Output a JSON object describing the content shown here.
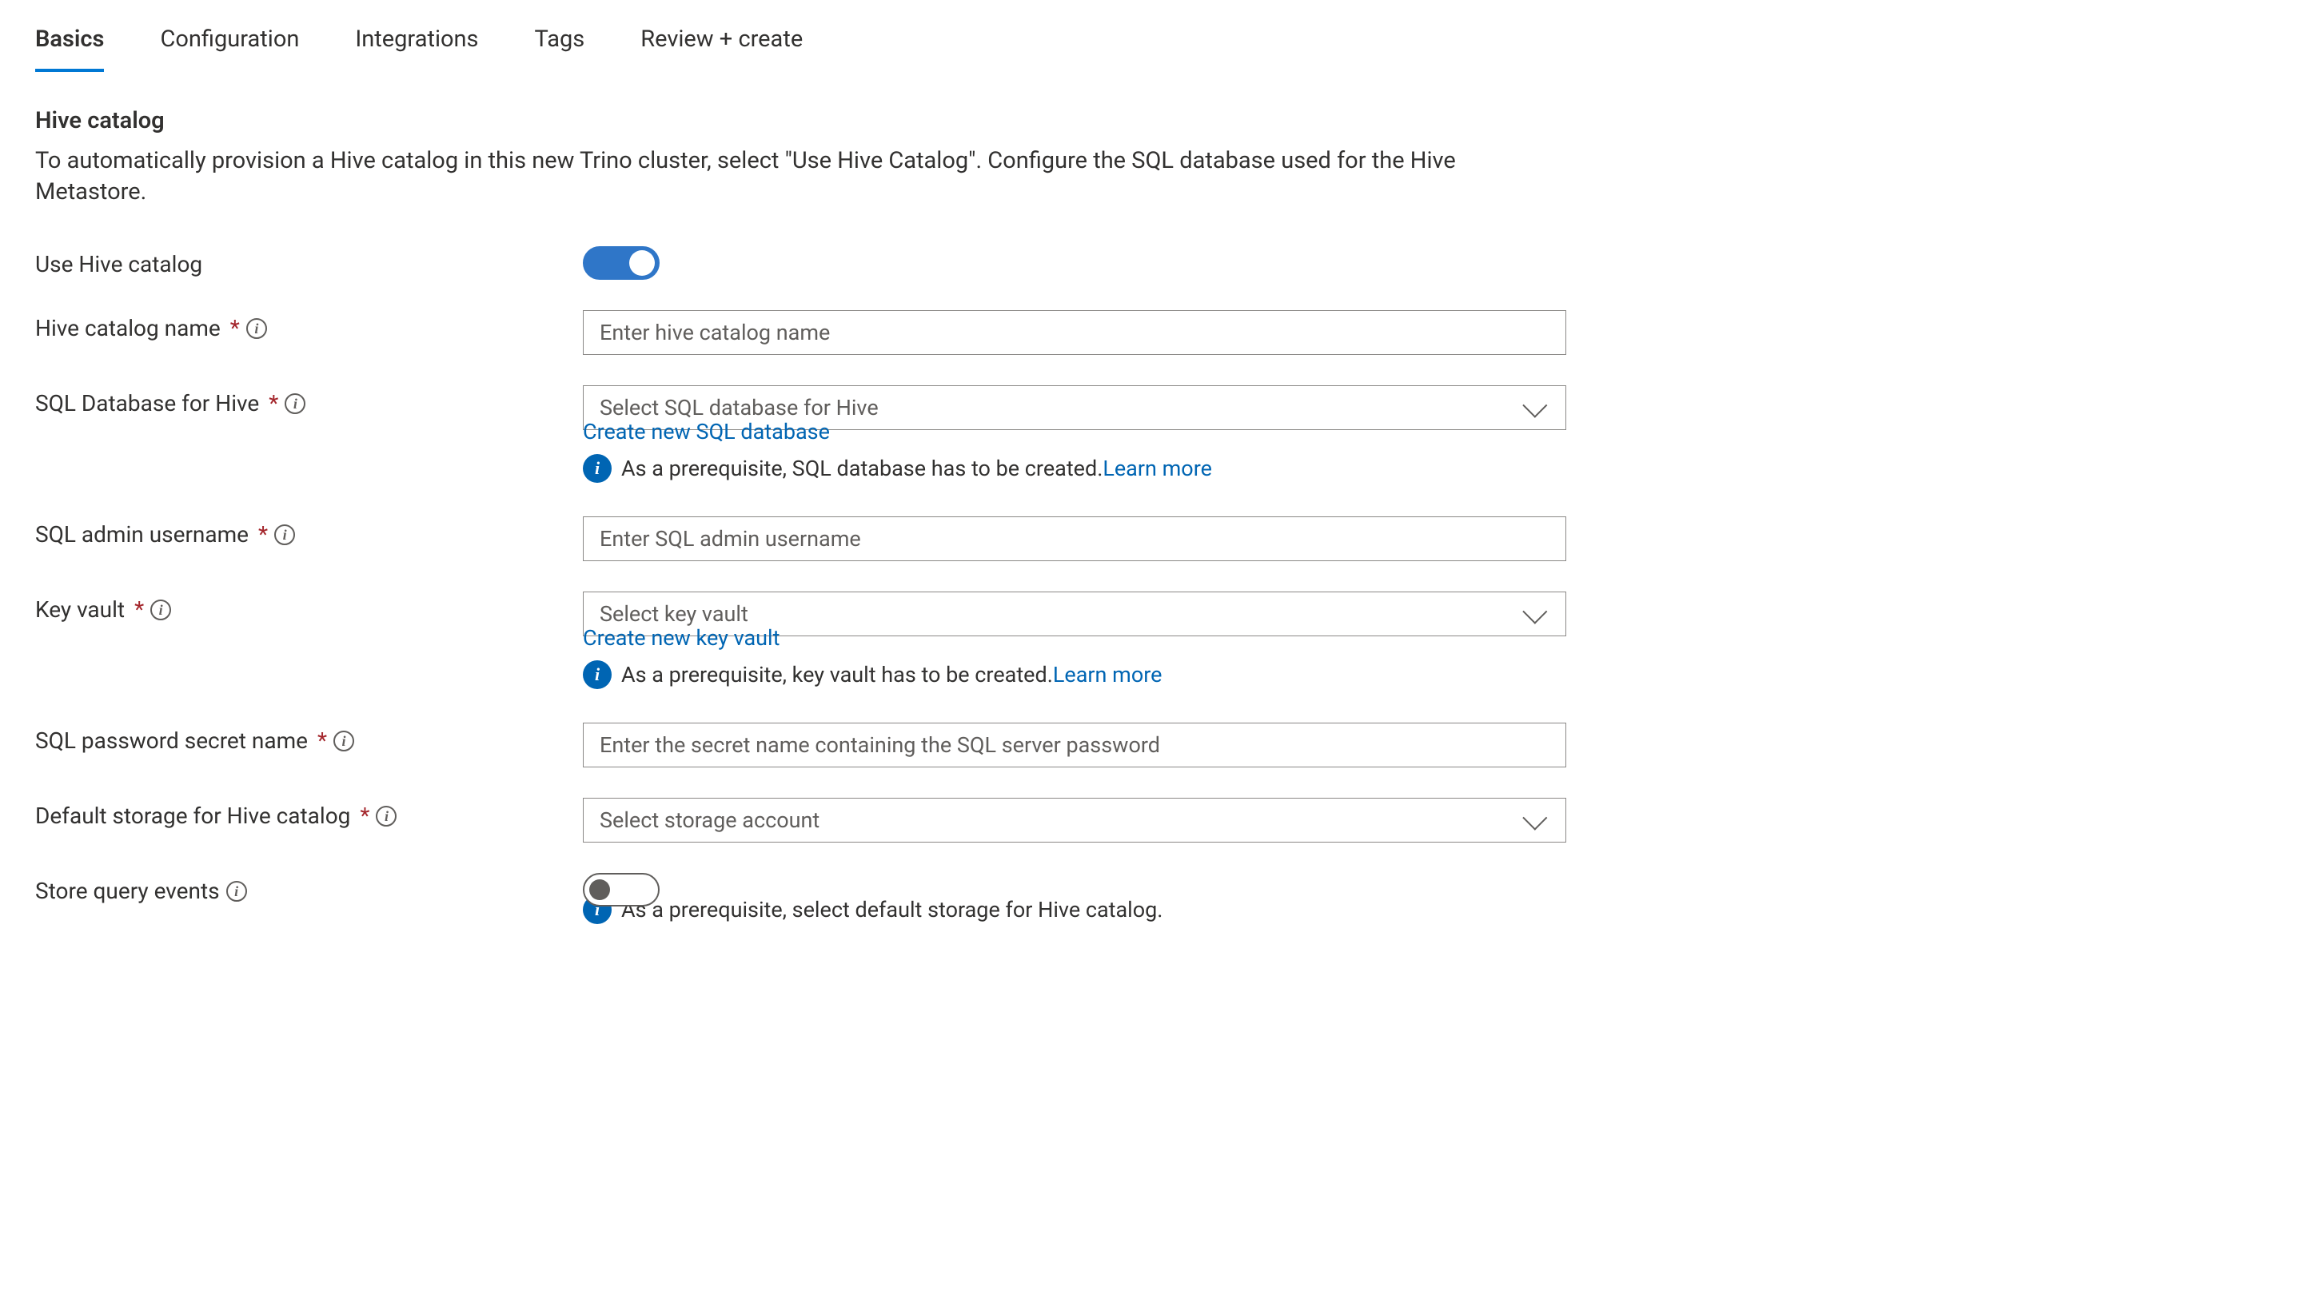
{
  "tabs": [
    "Basics",
    "Configuration",
    "Integrations",
    "Tags",
    "Review + create"
  ],
  "activeTab": 0,
  "section": {
    "title": "Hive catalog",
    "description": "To automatically provision a Hive catalog in this new Trino cluster, select \"Use Hive Catalog\". Configure the SQL database used for the Hive Metastore."
  },
  "labels": {
    "useHive": "Use Hive catalog",
    "catalogName": "Hive catalog name",
    "sqlDb": "SQL Database for Hive",
    "sqlUser": "SQL admin username",
    "keyVault": "Key vault",
    "secretName": "SQL password secret name",
    "defaultStorage": "Default storage for Hive catalog",
    "storeEvents": "Store query events"
  },
  "placeholders": {
    "catalogName": "Enter hive catalog name",
    "sqlDb": "Select SQL database for Hive",
    "sqlUser": "Enter SQL admin username",
    "keyVault": "Select key vault",
    "secretName": "Enter the secret name containing the SQL server password",
    "defaultStorage": "Select storage account"
  },
  "links": {
    "createSql": "Create new SQL database",
    "createKv": "Create new key vault",
    "learnMore": "Learn more"
  },
  "info": {
    "sqlPrereq": "As a prerequisite, SQL database has to be created.",
    "kvPrereq": "As a prerequisite, key vault has to be created.",
    "storagePrereq": "As a prerequisite, select default storage for Hive catalog."
  },
  "toggles": {
    "useHive": true,
    "storeEvents": false
  }
}
